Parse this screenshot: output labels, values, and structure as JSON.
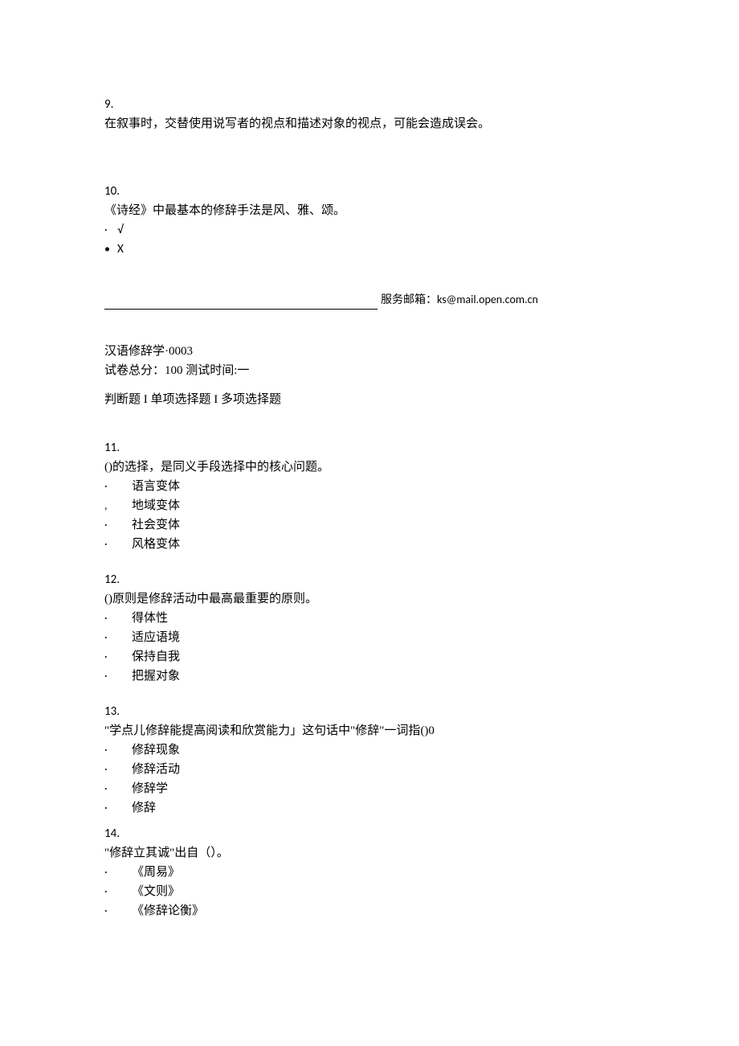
{
  "q9": {
    "num": "9.",
    "text": "在叙事时，交替使用说写者的视点和描述对象的视点，可能会造成误会。"
  },
  "q10": {
    "num": "10.",
    "text": "《诗经》中最基本的修辞手法是风、雅、颂。",
    "opt_true_bullet": "·",
    "opt_true": "√",
    "opt_false_bullet": "•",
    "opt_false": "X"
  },
  "footer": {
    "service_label": "服务邮箱：",
    "email": "ks@mail.open.com.cn"
  },
  "header2": {
    "title": "汉语修辞学·0003",
    "meta": "试卷总分：100 测试时间:一",
    "sections": "判断题 I 单项选择题 I 多项选择题"
  },
  "q11": {
    "num": "11.",
    "text": "()的选择，是同义手段选择中的核心问题。",
    "opts": [
      "语言变体",
      "地域变体",
      "社会变体",
      "风格变体"
    ],
    "bullets": [
      "·",
      ",",
      "·",
      "·"
    ]
  },
  "q12": {
    "num": "12.",
    "text": "()原则是修辞活动中最高最重要的原则。",
    "opts": [
      "得体性",
      "适应语境",
      "保持自我",
      "把握对象"
    ],
    "bullets": [
      "·",
      "·",
      "·",
      "·"
    ]
  },
  "q13": {
    "num": "13.",
    "text": "\"学点儿修辞能提高阅读和欣赏能力」这句话中\"修辞\"一词指()0",
    "opts": [
      "修辞现象",
      "修辞活动",
      "修辞学",
      "修辞"
    ],
    "bullets": [
      "·",
      "·",
      "·",
      "·"
    ]
  },
  "q14": {
    "num": "14.",
    "text": "\"修辞立其诚\"出自（）。",
    "opts": [
      "《周易》",
      "《文则》",
      "《修辞论衡》"
    ],
    "bullets": [
      "·",
      "·",
      "·"
    ]
  }
}
